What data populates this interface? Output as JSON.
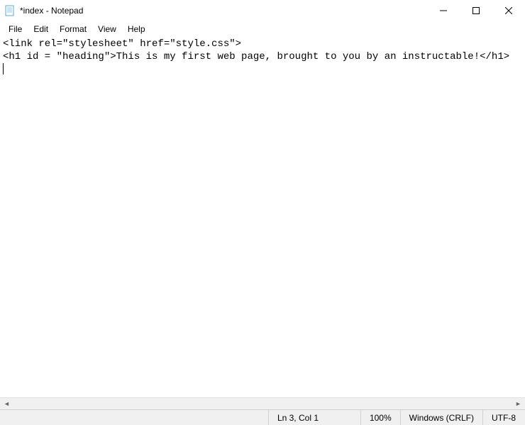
{
  "titlebar": {
    "title": "*index - Notepad"
  },
  "menubar": {
    "items": [
      "File",
      "Edit",
      "Format",
      "View",
      "Help"
    ]
  },
  "editor": {
    "line1": "<link rel=\"stylesheet\" href=\"style.css\">",
    "line2": "<h1 id = \"heading\">This is my first web page, brought to you by an instructable!</h1>"
  },
  "statusbar": {
    "position": "Ln 3, Col 1",
    "zoom": "100%",
    "line_ending": "Windows (CRLF)",
    "encoding": "UTF-8"
  }
}
